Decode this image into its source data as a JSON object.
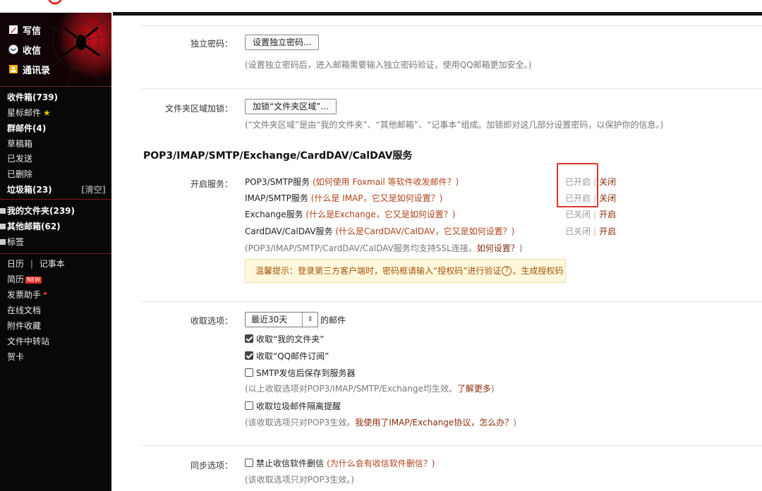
{
  "sidebar": {
    "actions": [
      {
        "label": "写信",
        "icon": "compose-icon"
      },
      {
        "label": "收信",
        "icon": "inbox-icon"
      },
      {
        "label": "通讯录",
        "icon": "contacts-icon"
      }
    ],
    "mailboxes": {
      "inbox": "收件箱(739)",
      "starred": "星标邮件",
      "group": "群邮件(4)",
      "drafts": "草稿箱",
      "sent": "已发送",
      "deleted": "已删除",
      "spam": "垃圾箱(23)",
      "spam_clear": "[清空]"
    },
    "folders": {
      "my_folders": "我的文件夹(239)",
      "other_mailboxes": "其他邮箱(62)",
      "tags": "标签"
    },
    "tools": {
      "calendar": "日历",
      "separator": "|",
      "notepad": "记事本",
      "resume": "简历",
      "resume_badge": "NEW",
      "invoice": "发票助手",
      "docs": "在线文档",
      "attachments": "附件收藏",
      "transfer": "文件中转站",
      "cards": "贺卡"
    }
  },
  "main": {
    "independent_password": {
      "label": "独立密码：",
      "button": "设置独立密码...",
      "hint": "(设置独立密码后，进入邮箱需要输入独立密码验证，使用QQ邮箱更加安全。)"
    },
    "folder_lock": {
      "label": "文件夹区域加锁：",
      "button": "加锁“文件夹区域”...",
      "hint": "(“文件夹区域”是由“我的文件夹”、“其他邮箱”、“记事本”组成。加锁即对这几部分设置密码，以保护你的信息。)"
    },
    "services_title": "POP3/IMAP/SMTP/Exchange/CardDAV/CalDAV服务",
    "services": {
      "label": "开启服务：",
      "items": [
        {
          "name": "POP3/SMTP服务",
          "link": "(如何使用 Foxmail 等软件收发邮件？)",
          "state": "已开启",
          "toggle": "关闭"
        },
        {
          "name": "IMAP/SMTP服务",
          "link": "(什么是 IMAP，它又是如何设置？)",
          "state": "已开启",
          "toggle": "关闭"
        },
        {
          "name": "Exchange服务",
          "link": "(什么是Exchange，它又是如何设置？)",
          "state": "已关闭",
          "toggle": "开启"
        },
        {
          "name": "CardDAV/CalDAV服务",
          "link": "(什么是CardDAV/CalDAV，它又是如何设置？)",
          "state": "已关闭",
          "toggle": "开启"
        }
      ],
      "pipe": "|",
      "ssl_hint": "(POP3/IMAP/SMTP/CardDAV/CalDAV服务均支持SSL连接。",
      "ssl_link": "如何设置？",
      "ssl_tail": ")",
      "tip_prefix": "温馨提示：登录第三方客户端时，密码框请输入“授权码”进行验证",
      "tip_help": "?",
      "tip_suffix": "。生成授权码"
    },
    "receive": {
      "label": "收取选项：",
      "select_value": "最近30天",
      "select_arrow": "⇕",
      "suffix": "的邮件",
      "options": [
        {
          "text": "收取“我的文件夹”",
          "checked": true
        },
        {
          "text": "收取“QQ邮件订阅”",
          "checked": true
        },
        {
          "text": "SMTP发信后保存到服务器",
          "checked": false
        }
      ],
      "hint1_prefix": "(以上收取选项对POP3/IMAP/SMTP/Exchange均生效。",
      "hint1_link": "了解更多",
      "hint1_tail": ")",
      "spam_option": {
        "text": "收取垃圾邮件隔离提醒",
        "checked": false
      },
      "hint2_prefix": "(该收取选项只对POP3生效。",
      "hint2_link": "我使用了IMAP/Exchange协议，怎么办？",
      "hint2_tail": ")"
    },
    "sync": {
      "label": "同步选项：",
      "option": {
        "text": "禁止收信软件删信",
        "checked": false
      },
      "option_link": "(为什么会有收信软件删信？)",
      "hint": "(该收取选项只对POP3生效。)"
    }
  },
  "colors": {
    "accent_red": "#e0332b",
    "link_orange": "#b0431a",
    "toggle_brown": "#8b2c0a",
    "tip_bg": "#fff8dc",
    "sidebar_bg": "#080808"
  }
}
